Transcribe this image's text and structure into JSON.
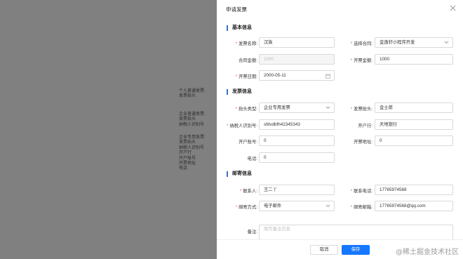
{
  "background_notes": [
    "个人普通发票:\n发票抬头",
    "企业普通发票:\n发票抬头\n纳税人识别号",
    "企业专用发票:\n发票抬头\n纳税人识别号\n开户行\n开户账号\n开票地址\n电话"
  ],
  "drawer": {
    "title": "申请发票",
    "close_icon": "close-icon"
  },
  "sections": {
    "basic": "基本信息",
    "invoice": "发票信息",
    "mail": "邮寄信息"
  },
  "form": {
    "invoice_name": {
      "label": "发票名称:",
      "value": "汉族"
    },
    "contract": {
      "label": "选择合同:",
      "value": "金逸轩小程序开发"
    },
    "contract_amount": {
      "label": "合同金额:",
      "value": "1000"
    },
    "invoice_amount": {
      "label": "开票金额:",
      "value": "1000"
    },
    "invoice_date": {
      "label": "开票日期:",
      "value": "2000-05-11"
    },
    "title_type": {
      "label": "抬头类型:",
      "value": "企业专用发票"
    },
    "invoice_title": {
      "label": "发票抬头:",
      "value": "金士郎"
    },
    "tax_id": {
      "label": "纳税人识别号:",
      "value": "sfdvdbfh42345343"
    },
    "bank": {
      "label": "开户行:",
      "value": "天地银行"
    },
    "bank_account": {
      "label": "开户账号:",
      "value": "0"
    },
    "invoice_address": {
      "label": "开票地址:",
      "value": "0"
    },
    "phone": {
      "label": "电话:",
      "value": "0"
    },
    "contact": {
      "label": "联系人:",
      "value": "王二丫"
    },
    "contact_phone": {
      "label": "联系电话:",
      "value": "17765974568"
    },
    "mail_method": {
      "label": "邮寄方式:",
      "value": "电子邮件"
    },
    "mail_email": {
      "label": "邮寄邮箱:",
      "value": "17765974568@qq.com"
    },
    "remark": {
      "label": "备注:",
      "placeholder": "填写备注信息"
    }
  },
  "footer": {
    "cancel": "取消",
    "save": "保存"
  },
  "watermark": "@稀土掘金技术社区",
  "colors": {
    "primary": "#1677ff",
    "required": "#ff4d4f",
    "overlay": "#808080"
  }
}
